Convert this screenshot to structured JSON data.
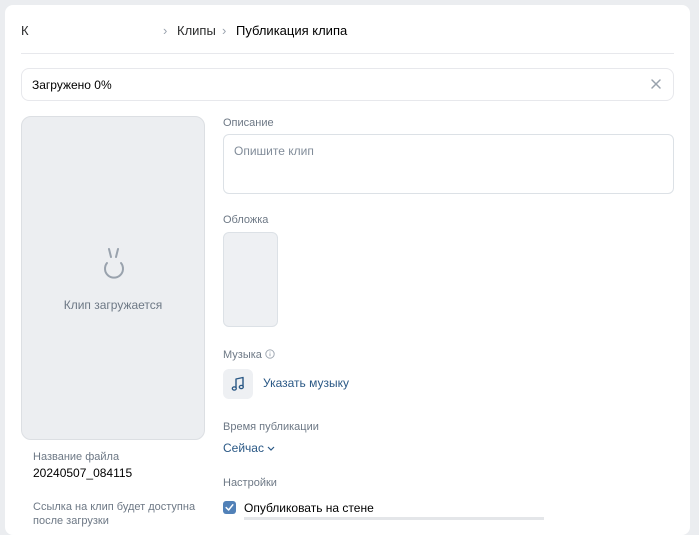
{
  "breadcrumbs": {
    "back_label": "К",
    "section": "Клипы",
    "current": "Публикация клипа"
  },
  "upload": {
    "status_text": "Загружено 0%"
  },
  "preview": {
    "loading_text": "Клип загружается"
  },
  "file": {
    "name_label": "Название файла",
    "name_value": "20240507_084115",
    "link_note": "Ссылка на клип будет доступна после загрузки"
  },
  "form": {
    "description_label": "Описание",
    "description_placeholder": "Опишите клип",
    "cover_label": "Обложка",
    "music_label": "Музыка",
    "music_link": "Указать музыку",
    "time_label": "Время публикации",
    "time_value": "Сейчас",
    "settings_label": "Настройки",
    "publish_wall_label": "Опубликовать на стене",
    "publish_wall_checked": true
  },
  "colors": {
    "accent": "#2a5885",
    "checkbox": "#5181b8",
    "muted": "#6d7885"
  }
}
